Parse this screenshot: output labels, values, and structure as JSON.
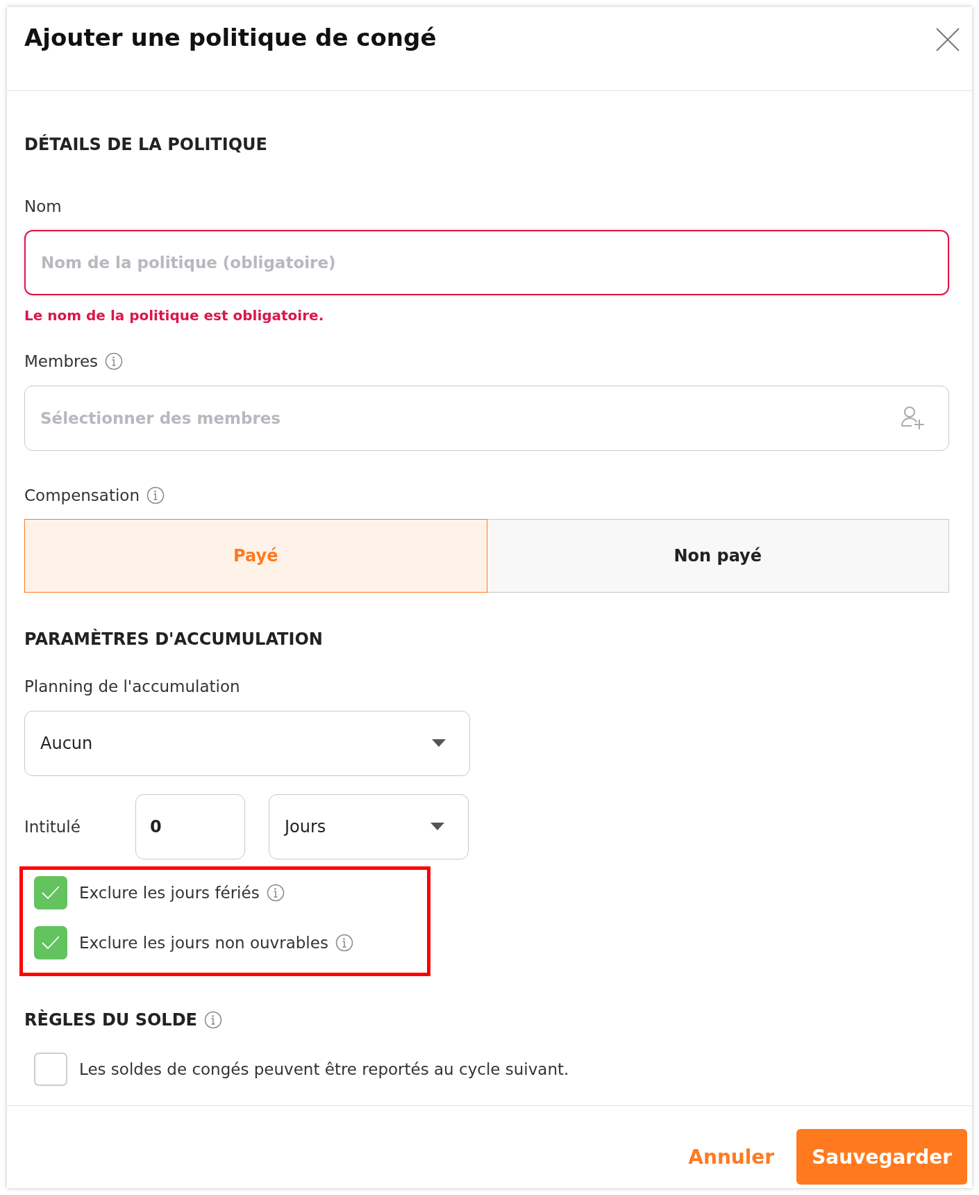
{
  "dialog": {
    "title": "Ajouter une politique de congé"
  },
  "details": {
    "heading": "DÉTAILS DE LA POLITIQUE",
    "name_field": {
      "label": "Nom",
      "placeholder": "Nom de la politique (obligatoire)",
      "error": "Le nom de la politique est obligatoire."
    },
    "members_field": {
      "label": "Membres",
      "placeholder": "Sélectionner des membres"
    },
    "compensation": {
      "label": "Compensation",
      "options": [
        {
          "label": "Payé",
          "selected": true
        },
        {
          "label": "Non payé",
          "selected": false
        }
      ]
    }
  },
  "accrual": {
    "heading": "PARAMÈTRES D'ACCUMULATION",
    "schedule": {
      "label": "Planning de l'accumulation",
      "value": "Aucun"
    },
    "entitlement": {
      "label": "Intitulé",
      "amount": "0",
      "unit": "Jours"
    },
    "exclusions": {
      "highlighted": true,
      "items": [
        {
          "label": "Exclure les jours fériés",
          "checked": true
        },
        {
          "label": "Exclure les jours non ouvrables",
          "checked": true
        }
      ]
    }
  },
  "balance_rules": {
    "heading": "RÈGLES DU SOLDE",
    "items": [
      {
        "label": "Les soldes de congés peuvent être reportés au cycle suivant.",
        "checked": false
      }
    ]
  },
  "footer": {
    "buttons": [
      {
        "label": "Annuler",
        "kind": "link"
      },
      {
        "label": "Sauvegarder",
        "kind": "primary"
      }
    ]
  }
}
